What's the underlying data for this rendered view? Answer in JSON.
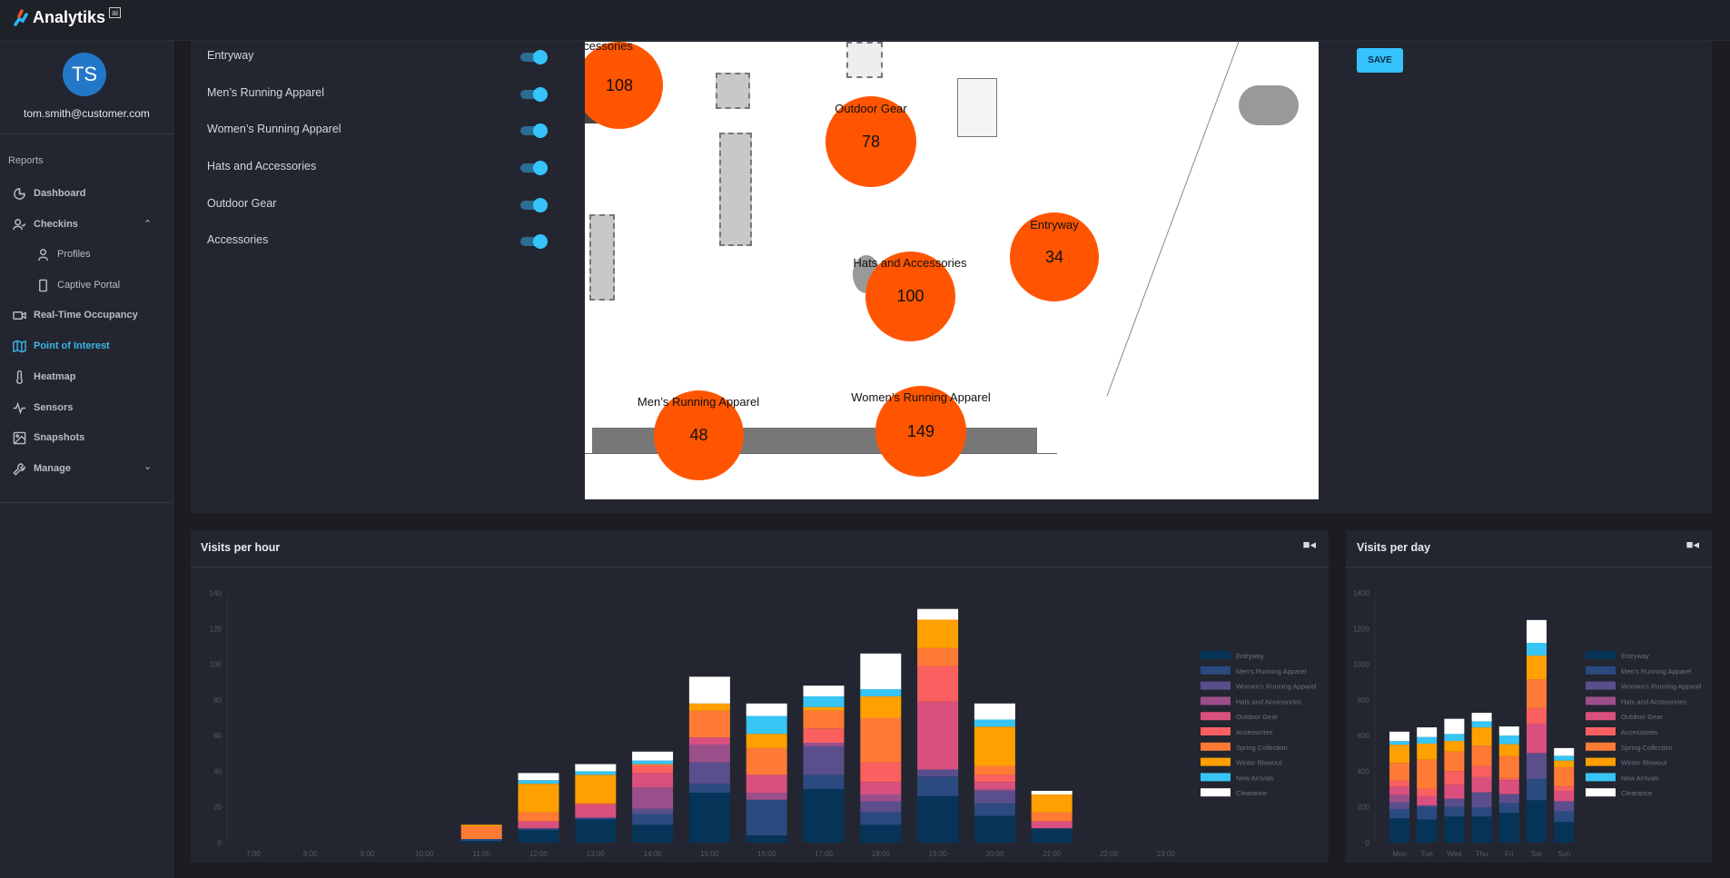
{
  "app": {
    "name": "Analytiks",
    "badge": "ai"
  },
  "user": {
    "initials": "TS",
    "email": "tom.smith@customer.com"
  },
  "sidebar": {
    "section": "Reports",
    "items": [
      {
        "label": "Dashboard",
        "icon": "pie-chart-icon"
      },
      {
        "label": "Checkins",
        "icon": "user-check-icon",
        "expanded": true
      },
      {
        "label": "Profiles",
        "icon": "user-icon",
        "sub": true
      },
      {
        "label": "Captive Portal",
        "icon": "tablet-icon",
        "sub": true
      },
      {
        "label": "Real-Time Occupancy",
        "icon": "video-icon"
      },
      {
        "label": "Point of Interest",
        "icon": "map-icon",
        "active": true
      },
      {
        "label": "Heatmap",
        "icon": "thermometer-icon"
      },
      {
        "label": "Sensors",
        "icon": "activity-icon"
      },
      {
        "label": "Snapshots",
        "icon": "image-icon"
      },
      {
        "label": "Manage",
        "icon": "wrench-icon",
        "expanded": false
      }
    ]
  },
  "zones": [
    {
      "label": "Entryway",
      "enabled": true
    },
    {
      "label": "Men’s Running Apparel",
      "enabled": true
    },
    {
      "label": "Women’s Running Apparel",
      "enabled": true
    },
    {
      "label": "Hats and Accessories",
      "enabled": true
    },
    {
      "label": "Outdoor Gear",
      "enabled": true
    },
    {
      "label": "Accessories",
      "enabled": true
    }
  ],
  "floorplan": {
    "bubbles": [
      {
        "label": "Accessories",
        "value": "108"
      },
      {
        "label": "Outdoor Gear",
        "value": "78"
      },
      {
        "label": "Entryway",
        "value": "34"
      },
      {
        "label": "Hats and Accessories",
        "value": "100"
      },
      {
        "label": "Men’s Running Apparel",
        "value": "48"
      },
      {
        "label": "Women’s Running Apparel",
        "value": "149"
      }
    ],
    "bubble_color": "#ff5500"
  },
  "save_label": "SAVE",
  "colors": {
    "accent": "#35c3fb",
    "active_nav": "#3ab6ea"
  },
  "chart_data": [
    {
      "type": "bar",
      "stacked": true,
      "title": "Visits per hour",
      "icon": "video-camera-icon",
      "categories": [
        "7:00",
        "8:00",
        "9:00",
        "10:00",
        "11:00",
        "12:00",
        "13:00",
        "14:00",
        "15:00",
        "16:00",
        "17:00",
        "18:00",
        "19:00",
        "20:00",
        "21:00",
        "22:00",
        "23:00"
      ],
      "ylim": [
        0,
        140
      ],
      "yticks": [
        "0",
        "20",
        "40",
        "60",
        "80",
        "100",
        "120",
        "140"
      ],
      "legend": "right",
      "series": [
        {
          "name": "Entryway",
          "color": "#053458",
          "values": [
            0,
            0,
            0,
            0,
            1,
            7,
            13,
            10,
            28,
            4,
            30,
            10,
            26,
            15,
            8,
            0,
            0
          ]
        },
        {
          "name": "Men's Running Apparel",
          "color": "#2a4a80",
          "values": [
            0,
            0,
            0,
            0,
            1,
            1,
            1,
            6,
            5,
            20,
            8,
            7,
            11,
            7,
            0,
            0,
            0
          ]
        },
        {
          "name": "Women's Running Apparel",
          "color": "#5a4e8c",
          "values": [
            0,
            0,
            0,
            0,
            0,
            0,
            0,
            3,
            12,
            0,
            16,
            6,
            4,
            7,
            0,
            0,
            0
          ]
        },
        {
          "name": "Hats and Accessories",
          "color": "#9b4f8a",
          "values": [
            0,
            0,
            0,
            0,
            0,
            0,
            0,
            12,
            10,
            4,
            2,
            4,
            0,
            1,
            0,
            0,
            0
          ]
        },
        {
          "name": "Outdoor Gear",
          "color": "#d9507e",
          "values": [
            0,
            0,
            0,
            0,
            0,
            4,
            7,
            8,
            4,
            10,
            0,
            7,
            38,
            4,
            4,
            0,
            0
          ]
        },
        {
          "name": "Accessories",
          "color": "#f9605f",
          "values": [
            0,
            0,
            0,
            0,
            0,
            0,
            1,
            4,
            0,
            0,
            8,
            11,
            20,
            4,
            0,
            0,
            0
          ]
        },
        {
          "name": "Spring Collection",
          "color": "#ff7a35",
          "values": [
            0,
            0,
            0,
            0,
            7,
            5,
            0,
            1,
            15,
            15,
            10,
            25,
            10,
            5,
            5,
            0,
            0
          ]
        },
        {
          "name": "Winter Blowout",
          "color": "#ffa000",
          "values": [
            0,
            0,
            0,
            0,
            1,
            16,
            16,
            0,
            4,
            8,
            2,
            12,
            16,
            22,
            10,
            0,
            0
          ]
        },
        {
          "name": "New Arrivals",
          "color": "#36c5f4",
          "values": [
            0,
            0,
            0,
            0,
            0,
            2,
            2,
            2,
            0,
            10,
            6,
            4,
            0,
            4,
            0,
            0,
            0
          ]
        },
        {
          "name": "Clearance",
          "color": "#ffffff",
          "values": [
            0,
            0,
            0,
            0,
            0,
            4,
            4,
            5,
            15,
            7,
            6,
            20,
            6,
            9,
            2,
            0,
            0
          ]
        }
      ]
    },
    {
      "type": "bar",
      "stacked": true,
      "title": "Visits per day",
      "icon": "video-camera-icon",
      "categories": [
        "Mon",
        "Tue",
        "Wed",
        "Thu",
        "Fri",
        "Sat",
        "Sun"
      ],
      "ylim": [
        0,
        1400
      ],
      "yticks": [
        "0",
        "200",
        "400",
        "600",
        "800",
        "1000",
        "1200",
        "1400"
      ],
      "legend": "right",
      "series": [
        {
          "name": "Entryway",
          "color": "#053458",
          "values": [
            136,
            129,
            146,
            146,
            167,
            238,
            116
          ]
        },
        {
          "name": "Men's Running Apparel",
          "color": "#2a4a80",
          "values": [
            51,
            71,
            54,
            51,
            54,
            119,
            60
          ]
        },
        {
          "name": "Women's Running Apparel",
          "color": "#5a4e8c",
          "values": [
            39,
            9,
            46,
            85,
            51,
            145,
            56
          ]
        },
        {
          "name": "Hats and Accessories",
          "color": "#9b4f8a",
          "values": [
            42,
            0,
            0,
            0,
            0,
            0,
            0
          ]
        },
        {
          "name": "Outdoor Gear",
          "color": "#d9507e",
          "values": [
            46,
            51,
            78,
            85,
            78,
            165,
            58
          ]
        },
        {
          "name": "Accessories",
          "color": "#f9605f",
          "values": [
            34,
            43,
            77,
            63,
            12,
            87,
            26
          ]
        },
        {
          "name": "Spring Collection",
          "color": "#ff7a35",
          "values": [
            99,
            162,
            109,
            114,
            124,
            162,
            107
          ]
        },
        {
          "name": "Winter Blowout",
          "color": "#ffa000",
          "values": [
            102,
            90,
            60,
            102,
            66,
            133,
            37
          ]
        },
        {
          "name": "New Arrivals",
          "color": "#36c5f4",
          "values": [
            20,
            37,
            39,
            34,
            48,
            71,
            27
          ]
        },
        {
          "name": "Clearance",
          "color": "#ffffff",
          "values": [
            53,
            54,
            85,
            48,
            51,
            128,
            43
          ]
        }
      ]
    }
  ]
}
